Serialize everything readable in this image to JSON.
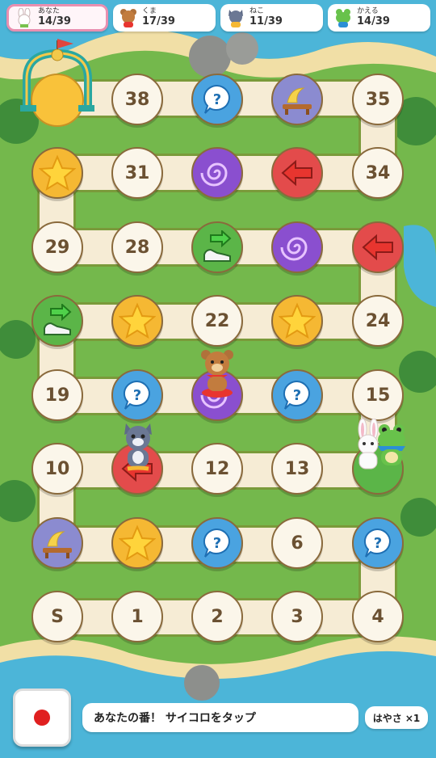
{
  "players": [
    {
      "name": "あなた",
      "score": "14/39",
      "icon": "rabbit-icon",
      "active": true
    },
    {
      "name": "くま",
      "score": "17/39",
      "icon": "bear-icon",
      "active": false
    },
    {
      "name": "ねこ",
      "score": "11/39",
      "icon": "cat-icon",
      "active": false
    },
    {
      "name": "かえる",
      "score": "14/39",
      "icon": "frog-icon",
      "active": false
    }
  ],
  "tiles": {
    "start": "S",
    "t1": "1",
    "t2": "2",
    "t3": "3",
    "t4": "4",
    "t6": "6",
    "t10": "10",
    "t12": "12",
    "t13": "13",
    "t15": "15",
    "t19": "19",
    "t22": "22",
    "t24": "24",
    "t28": "28",
    "t29": "29",
    "t31": "31",
    "t34": "34",
    "t35": "35",
    "t38": "38"
  },
  "status": {
    "message": "あなたの番！ サイコロをタップ",
    "speed": "はやさ ×1"
  },
  "colors": {
    "question": "#4aa3e0",
    "vortex": "#8a4fcf",
    "arrow_back": "#e34b4b",
    "boost": "#5bb548",
    "star": "#f5b833",
    "rest": "#8b8bd0",
    "active_border": "#e98fb0"
  }
}
